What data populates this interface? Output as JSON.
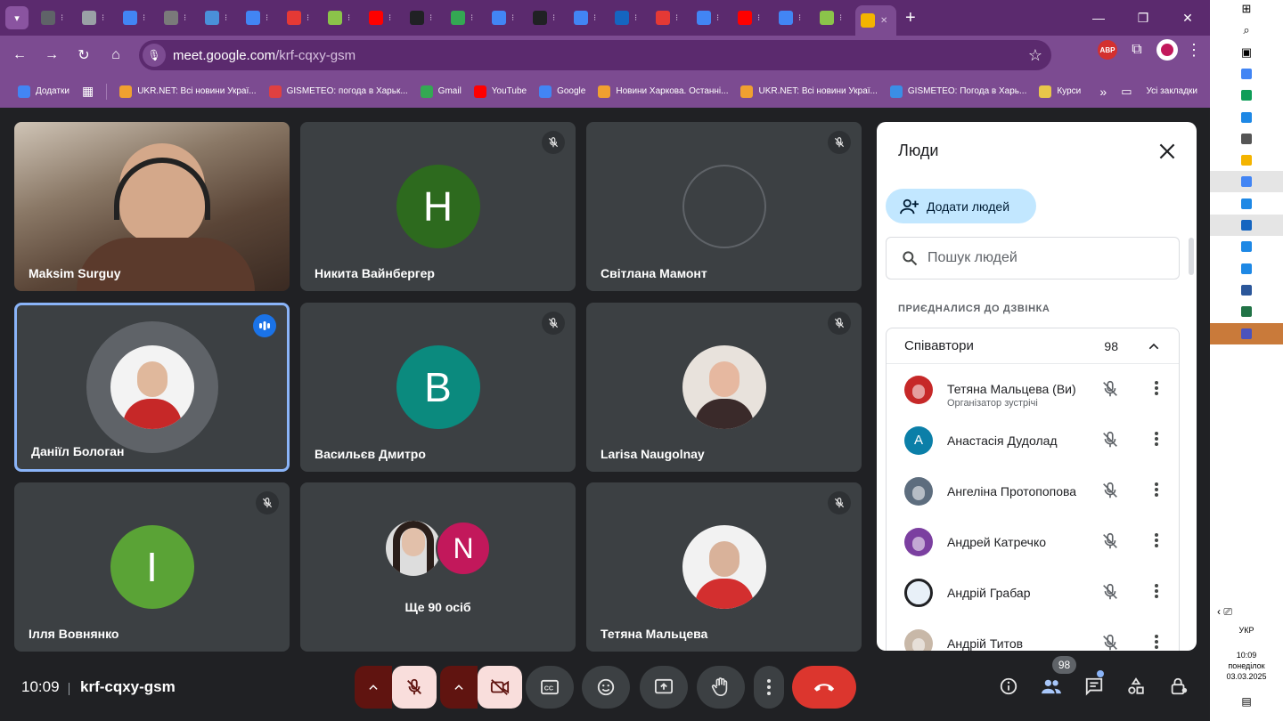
{
  "browser": {
    "tabs_count": 21,
    "url_host": "meet.google.com",
    "url_path": "/krf-cqxy-gsm",
    "bookmarks": [
      {
        "label": "Додатки",
        "color": "#4285f4"
      },
      {
        "label": "UKR.NET: Всі новини Украї...",
        "color": "#f0a030"
      },
      {
        "label": "GISMETEO: погода в Харьк...",
        "color": "#e04040"
      },
      {
        "label": "Gmail",
        "color": "#34a853"
      },
      {
        "label": "YouTube",
        "color": "#ff0000"
      },
      {
        "label": "Google",
        "color": "#4285f4"
      },
      {
        "label": "Новини Харкова. Останні...",
        "color": "#f0a030"
      },
      {
        "label": "UKR.NET: Всі новини Украї...",
        "color": "#f0a030"
      },
      {
        "label": "GISMETEO: Погода в Харь...",
        "color": "#3a8ee6"
      },
      {
        "label": "Курси",
        "color": "#e8c64a"
      }
    ],
    "all_bookmarks": "Усі закладки",
    "abp_label": "ABP"
  },
  "tiles": [
    {
      "name": "Maksim Surguy",
      "type": "video"
    },
    {
      "name": "Никита Вайнбергер",
      "type": "letter",
      "letter": "H",
      "color": "#2d6a1e",
      "muted": true
    },
    {
      "name": "Світлана Мамонт",
      "type": "blank",
      "color": "#3c4043",
      "muted": true
    },
    {
      "name": "Даніїл Бологан",
      "type": "photo",
      "speaking": true
    },
    {
      "name": "Васильєв Дмитро",
      "type": "letter",
      "letter": "B",
      "color": "#0b8a7e",
      "muted": true
    },
    {
      "name": "Larisa Naugolnay",
      "type": "photo",
      "muted": true
    },
    {
      "name": "Ілля Вовнянко",
      "type": "letter",
      "letter": "I",
      "color": "#5aa336",
      "muted": true
    },
    {
      "name": "Ще 90 осіб",
      "type": "group",
      "letter": "N",
      "color": "#c2185b"
    },
    {
      "name": "Тетяна Мальцева",
      "type": "photo",
      "muted": true
    }
  ],
  "panel": {
    "title": "Люди",
    "add_people": "Додати людей",
    "search_placeholder": "Пошук людей",
    "section_label": "ПРИЄДНАЛИСЯ ДО ДЗВІНКА",
    "group_title": "Співавтори",
    "group_count": "98",
    "people": [
      {
        "name": "Тетяна Мальцева (Ви)",
        "role": "Організатор зустрічі",
        "avatar": "photo",
        "color": "#c62828"
      },
      {
        "name": "Анастасія Дудолад",
        "avatar": "letter",
        "letter": "A",
        "color": "#0b7fa8"
      },
      {
        "name": "Ангеліна Протопопова",
        "avatar": "photo",
        "color": "#5d6d7e"
      },
      {
        "name": "Андрей Катречко",
        "avatar": "photo",
        "color": "#7b3fa0"
      },
      {
        "name": "Андрій Грабар",
        "avatar": "photo",
        "color": "#e8f0f8"
      },
      {
        "name": "Андрій Титов",
        "avatar": "photo",
        "color": "#c8b8a8"
      }
    ]
  },
  "controls": {
    "time": "10:09",
    "meeting_code": "krf-cqxy-gsm",
    "participants_count": "98"
  },
  "taskbar": {
    "lang": "УКР",
    "time": "10:09",
    "day": "понеділок",
    "date": "03.03.2025"
  }
}
